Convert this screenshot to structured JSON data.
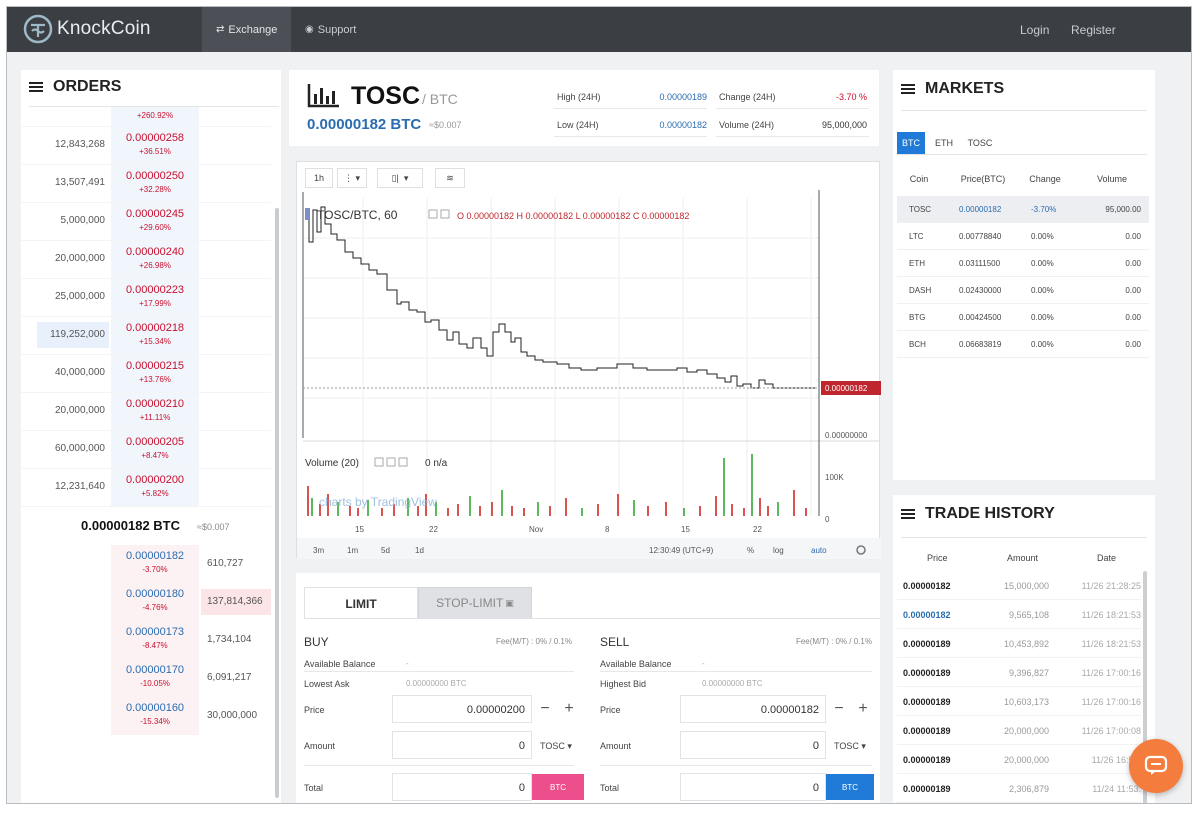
{
  "nav": {
    "logo_text": "KnockCoin",
    "exchange_label": "Exchange",
    "support_label": "Support",
    "login_label": "Login",
    "register_label": "Register"
  },
  "orders": {
    "title": "ORDERS",
    "top_partial_change": "+260.92%",
    "asks": [
      {
        "volume": "12,843,268",
        "price": "0.00000258",
        "change": "+36.51%",
        "bar": 0.0
      },
      {
        "volume": "13,507,491",
        "price": "0.00000250",
        "change": "+32.28%",
        "bar": 0.0
      },
      {
        "volume": "5,000,000",
        "price": "0.00000245",
        "change": "+29.60%",
        "bar": 0.0
      },
      {
        "volume": "20,000,000",
        "price": "0.00000240",
        "change": "+26.98%",
        "bar": 0.0
      },
      {
        "volume": "25,000,000",
        "price": "0.00000223",
        "change": "+17.99%",
        "bar": 0.0
      },
      {
        "volume": "119,252,000",
        "price": "0.00000218",
        "change": "+15.34%",
        "bar": 1.0
      },
      {
        "volume": "40,000,000",
        "price": "0.00000215",
        "change": "+13.76%",
        "bar": 0.0
      },
      {
        "volume": "20,000,000",
        "price": "0.00000210",
        "change": "+11.11%",
        "bar": 0.0
      },
      {
        "volume": "60,000,000",
        "price": "0.00000205",
        "change": "+8.47%",
        "bar": 0.0
      },
      {
        "volume": "12,231,640",
        "price": "0.00000200",
        "change": "+5.82%",
        "bar": 0.0
      }
    ],
    "current_price": "0.00000182 BTC",
    "current_sub": "≈$0.007",
    "bids": [
      {
        "price": "0.00000182",
        "change": "-3.70%",
        "volume": "610,727",
        "bar": 0.0
      },
      {
        "price": "0.00000180",
        "change": "-4.76%",
        "volume": "137,814,366",
        "bar": 1.0
      },
      {
        "price": "0.00000173",
        "change": "-8.47%",
        "volume": "1,734,104",
        "bar": 0.0
      },
      {
        "price": "0.00000170",
        "change": "-10.05%",
        "volume": "6,091,217",
        "bar": 0.0
      },
      {
        "price": "0.00000160",
        "change": "-15.34%",
        "volume": "30,000,000",
        "bar": 0.0
      }
    ]
  },
  "ticker": {
    "symbol": "TOSC",
    "quote": "/ BTC",
    "price": "0.00000182 BTC",
    "price_sub": "≈$0.007",
    "high_label": "High (24H)",
    "high_value": "0.00000189",
    "low_label": "Low (24H)",
    "low_value": "0.00000182",
    "change_label": "Change (24H)",
    "change_value": "-3.70 %",
    "volume_label": "Volume (24H)",
    "volume_value": "95,000,000"
  },
  "chart": {
    "toolbar": {
      "interval": "1h"
    },
    "legend": "TOSC/BTC, 60",
    "ohlc": "O 0.00000182  H 0.00000182  L 0.00000182  C 0.00000182",
    "last_price_tag": "0.00000182",
    "axis_zero": "0.00000000",
    "volume_legend": "Volume (20)",
    "volume_value": "0  n/a",
    "volume_axis_top": "100K",
    "volume_axis_zero": "0",
    "watermark": "charts by TradingView",
    "x_ticks": [
      "15",
      "22",
      "Nov",
      "8",
      "15",
      "22"
    ],
    "ranges": [
      "3m",
      "1m",
      "5d",
      "1d"
    ],
    "clock": "12:30:49 (UTC+9)",
    "pct": "%",
    "log": "log",
    "auto": "auto",
    "colors": {
      "line": "#222222",
      "price_tag": "#c0262d",
      "vol_red": "#d9534f",
      "vol_green": "#5cb85c"
    }
  },
  "form": {
    "tab_limit": "LIMIT",
    "tab_stop": "STOP-LIMIT",
    "buy": {
      "title": "BUY",
      "fee": "Fee(M/T) : 0% / 0.1%",
      "avail_label": "Available Balance",
      "avail_value": "-",
      "best_label": "Lowest Ask",
      "best_value": "0.00000000 BTC",
      "price_label": "Price",
      "price_value": "0.00000200",
      "amount_label": "Amount",
      "amount_value": "0",
      "amount_unit": "TOSC",
      "total_label": "Total",
      "total_value": "0",
      "button": "BTC"
    },
    "sell": {
      "title": "SELL",
      "fee": "Fee(M/T) : 0% / 0.1%",
      "avail_label": "Available Balance",
      "avail_value": "-",
      "best_label": "Highest Bid",
      "best_value": "0.00000000 BTC",
      "price_label": "Price",
      "price_value": "0.00000182",
      "amount_label": "Amount",
      "amount_value": "0",
      "amount_unit": "TOSC",
      "total_label": "Total",
      "total_value": "0",
      "button": "BTC"
    }
  },
  "markets": {
    "title": "MARKETS",
    "tabs": [
      "BTC",
      "ETH",
      "TOSC"
    ],
    "headers": [
      "Coin",
      "Price(BTC)",
      "Change",
      "Volume"
    ],
    "rows": [
      {
        "coin": "TOSC",
        "price": "0.00000182",
        "change": "-3.70%",
        "volume": "95,000.00"
      },
      {
        "coin": "LTC",
        "price": "0.00778840",
        "change": "0.00%",
        "volume": "0.00"
      },
      {
        "coin": "ETH",
        "price": "0.03111500",
        "change": "0.00%",
        "volume": "0.00"
      },
      {
        "coin": "DASH",
        "price": "0.02430000",
        "change": "0.00%",
        "volume": "0.00"
      },
      {
        "coin": "BTG",
        "price": "0.00424500",
        "change": "0.00%",
        "volume": "0.00"
      },
      {
        "coin": "BCH",
        "price": "0.06683819",
        "change": "0.00%",
        "volume": "0.00"
      }
    ]
  },
  "history": {
    "title": "TRADE HISTORY",
    "headers": [
      "Price",
      "Amount",
      "Date"
    ],
    "rows": [
      {
        "price": "0.00000182",
        "amount": "15,000,000",
        "date": "11/26 21:28:25",
        "side": "sell"
      },
      {
        "price": "0.00000182",
        "amount": "9,565,108",
        "date": "11/26 18:21:53",
        "side": "buy"
      },
      {
        "price": "0.00000189",
        "amount": "10,453,892",
        "date": "11/26 18:21:53",
        "side": "sell"
      },
      {
        "price": "0.00000189",
        "amount": "9,396,827",
        "date": "11/26 17:00:16",
        "side": "sell"
      },
      {
        "price": "0.00000189",
        "amount": "10,603,173",
        "date": "11/26 17:00:16",
        "side": "sell"
      },
      {
        "price": "0.00000189",
        "amount": "20,000,000",
        "date": "11/26 17:00:08",
        "side": "sell"
      },
      {
        "price": "0.00000189",
        "amount": "20,000,000",
        "date": "11/26 16:54:",
        "side": "sell"
      },
      {
        "price": "0.00000189",
        "amount": "2,306,879",
        "date": "11/24 11:53:",
        "side": "sell"
      }
    ]
  },
  "colors": {
    "accent_blue": "#1f7ad8",
    "ask_red": "#c8102e",
    "bid_blue": "#2b6cb0",
    "buy_pink": "#ec4f8b",
    "chat_orange": "#f47c3c",
    "nav_bg": "#3b3e43"
  }
}
